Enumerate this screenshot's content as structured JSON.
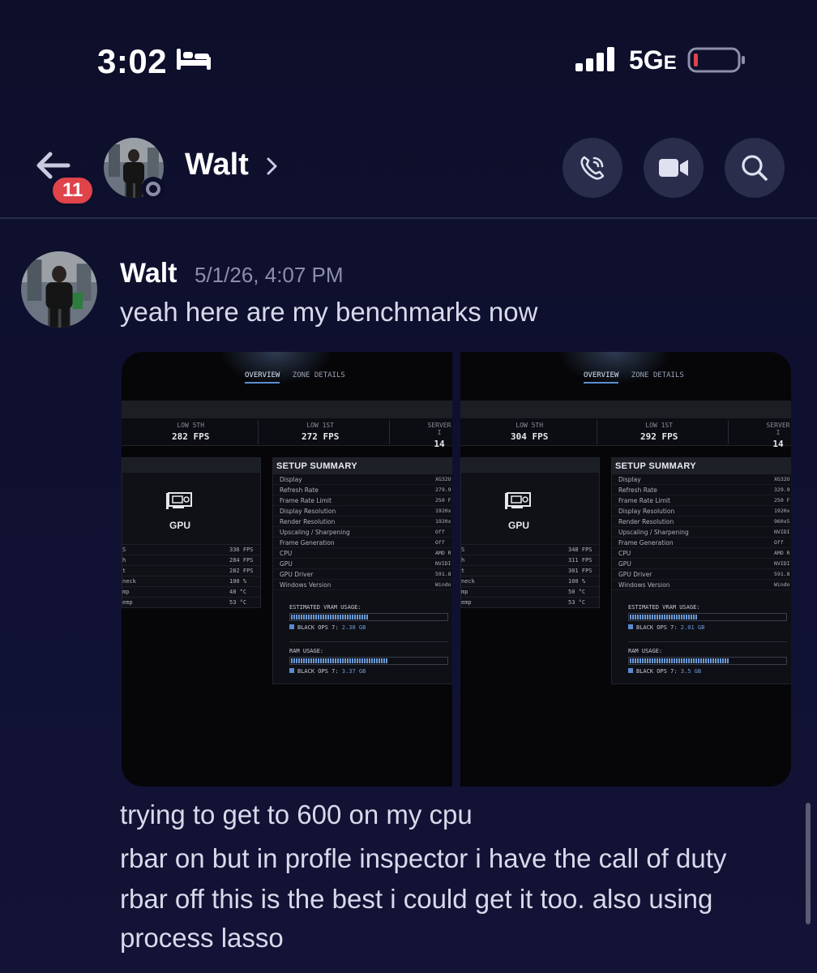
{
  "status_bar": {
    "time": "3:02",
    "network": "5G",
    "network_suffix": "E",
    "icons": [
      "sleep-focus-icon",
      "cellular-signal-icon",
      "battery-low-icon"
    ]
  },
  "header": {
    "back_badge": "11",
    "contact_name": "Walt",
    "buttons": [
      "voice-call",
      "video-call",
      "search"
    ]
  },
  "message": {
    "author": "Walt",
    "timestamp": "5/1/26, 4:07 PM",
    "text_before_images": "yeah here are my benchmarks now",
    "lines_after_images": [
      "trying to get to 600 on my cpu",
      "rbar on but in profle inspector i have the call of duty",
      "rbar off this is the best i could get it too. also using",
      "process lasso"
    ]
  },
  "screenshots": [
    {
      "tab_active": "OVERVIEW",
      "tab_other": "ZONE DETAILS",
      "stats": [
        {
          "label": "LOW 5TH",
          "value": "282 FPS"
        },
        {
          "label": "LOW 1ST",
          "value": "272 FPS"
        },
        {
          "label": "SERVER I",
          "value": "14"
        }
      ],
      "gpu_label": "GPU",
      "gpu_rows": [
        {
          "k": "S",
          "v": "336 FPS"
        },
        {
          "k": "h",
          "v": "284 FPS"
        },
        {
          "k": "t",
          "v": "282 FPS"
        },
        {
          "k": "neck",
          "v": "100 %"
        },
        {
          "k": "mp",
          "v": "48 °C"
        },
        {
          "k": "emp",
          "v": "53 °C"
        }
      ],
      "setup_title": "SETUP SUMMARY",
      "setup_rows": [
        {
          "k": "Display",
          "v": "XG32U"
        },
        {
          "k": "Refresh Rate",
          "v": "279.9"
        },
        {
          "k": "Frame Rate Limit",
          "v": "250 F"
        },
        {
          "k": "Display Resolution",
          "v": "1920x"
        },
        {
          "k": "Render Resolution",
          "v": "1920x"
        },
        {
          "k": "Upscaling / Sharpening",
          "v": "Off"
        },
        {
          "k": "Frame Generation",
          "v": "Off"
        },
        {
          "k": "CPU",
          "v": "AMD R"
        },
        {
          "k": "GPU",
          "v": "NVIDI"
        },
        {
          "k": "GPU Driver",
          "v": "591.8"
        },
        {
          "k": "Windows Version",
          "v": "Windo"
        }
      ],
      "vram_label": "ESTIMATED VRAM USAGE:",
      "vram_game": "BLACK OPS 7:",
      "vram_value": "2.38 GB",
      "vram_fill": 0.5,
      "ram_label": "RAM USAGE:",
      "ram_game": "BLACK OPS 7:",
      "ram_value": "3.37 GB",
      "ram_fill": 0.62
    },
    {
      "tab_active": "OVERVIEW",
      "tab_other": "ZONE DETAILS",
      "stats": [
        {
          "label": "LOW 5TH",
          "value": "304 FPS"
        },
        {
          "label": "LOW 1ST",
          "value": "292 FPS"
        },
        {
          "label": "SERVER I",
          "value": "14"
        }
      ],
      "gpu_label": "GPU",
      "gpu_rows": [
        {
          "k": "S",
          "v": "348 FPS"
        },
        {
          "k": "h",
          "v": "311 FPS"
        },
        {
          "k": "t",
          "v": "301 FPS"
        },
        {
          "k": "neck",
          "v": "100 %"
        },
        {
          "k": "mp",
          "v": "50 °C"
        },
        {
          "k": "emp",
          "v": "53 °C"
        }
      ],
      "setup_title": "SETUP SUMMARY",
      "setup_rows": [
        {
          "k": "Display",
          "v": "XG32U"
        },
        {
          "k": "Refresh Rate",
          "v": "329.9"
        },
        {
          "k": "Frame Rate Limit",
          "v": "250 F"
        },
        {
          "k": "Display Resolution",
          "v": "1920x"
        },
        {
          "k": "Render Resolution",
          "v": "960x5"
        },
        {
          "k": "Upscaling / Sharpening",
          "v": "NVIDI"
        },
        {
          "k": "Frame Generation",
          "v": "Off"
        },
        {
          "k": "CPU",
          "v": "AMD R"
        },
        {
          "k": "GPU",
          "v": "NVIDI"
        },
        {
          "k": "GPU Driver",
          "v": "591.8"
        },
        {
          "k": "Windows Version",
          "v": "Windo"
        }
      ],
      "vram_label": "ESTIMATED VRAM USAGE:",
      "vram_game": "BLACK OPS 7:",
      "vram_value": "2.01 GB",
      "vram_fill": 0.44,
      "ram_label": "RAM USAGE:",
      "ram_game": "BLACK OPS 7:",
      "ram_value": "3.5 GB",
      "ram_fill": 0.64
    }
  ]
}
